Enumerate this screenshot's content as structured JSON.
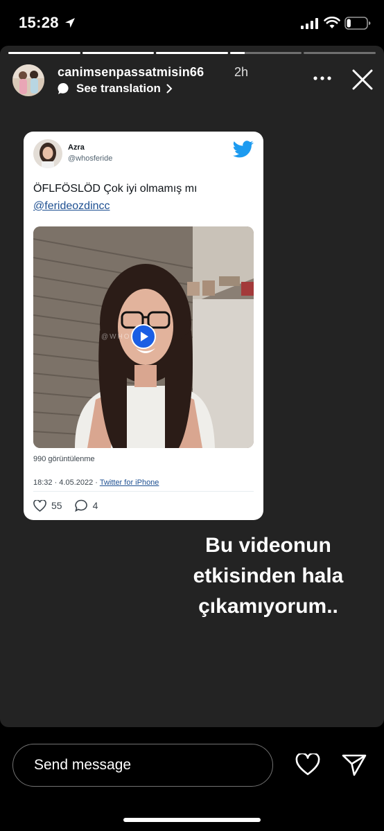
{
  "status_bar": {
    "time": "15:28",
    "icons": [
      "location-arrow-icon",
      "signal-bars-icon",
      "wifi-icon",
      "battery-icon"
    ],
    "battery_level": 0.2
  },
  "story": {
    "progress_segments": [
      1,
      1,
      1,
      0.2,
      0
    ],
    "username": "canimsenpassatmisin66",
    "time_ago": "2h",
    "translation_label": "See translation",
    "icons": [
      "more-icon",
      "close-icon"
    ]
  },
  "tweet": {
    "name": "Azra",
    "handle": "@whosferide",
    "text": "ÖFLFÖSLÖD Çok iyi olmamış mı",
    "mention": "@ferideozdincc",
    "watermark": "@WHOS",
    "views": "990 görüntülenme",
    "timestamp": "18:32 · 4.05.2022 · ",
    "source": "Twitter for iPhone",
    "likes": "55",
    "replies": "4",
    "colors": {
      "link": "#1d4f91",
      "bird": "#1d9bf0",
      "play": "#1a5ee4"
    }
  },
  "caption": {
    "lines": [
      "Bu videonun",
      "etkisinden hala",
      "çıkamıyorum.."
    ]
  },
  "bottom": {
    "placeholder": "Send message",
    "icons": [
      "heart-icon",
      "send-icon"
    ]
  }
}
